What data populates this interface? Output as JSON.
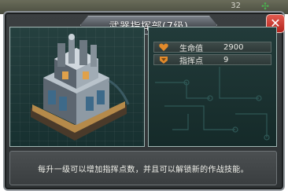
{
  "background": {
    "top_number": "32",
    "icon": "clover-icon"
  },
  "dialog": {
    "title": "武器指挥部(7级)",
    "close_icon": "close-icon"
  },
  "building": {
    "icon": "command-building-icon"
  },
  "stats": [
    {
      "icon": "heart-shield-icon",
      "label": "生命值",
      "value": "2900"
    },
    {
      "icon": "command-badge-icon",
      "label": "指挥点",
      "value": "9"
    }
  ],
  "description": "每升一级可以增加指挥点数，并且可以解锁新的作战技能。",
  "colors": {
    "accent_red": "#c43a30",
    "panel_teal": "#1f3636",
    "icon_orange": "#e28a2b"
  }
}
